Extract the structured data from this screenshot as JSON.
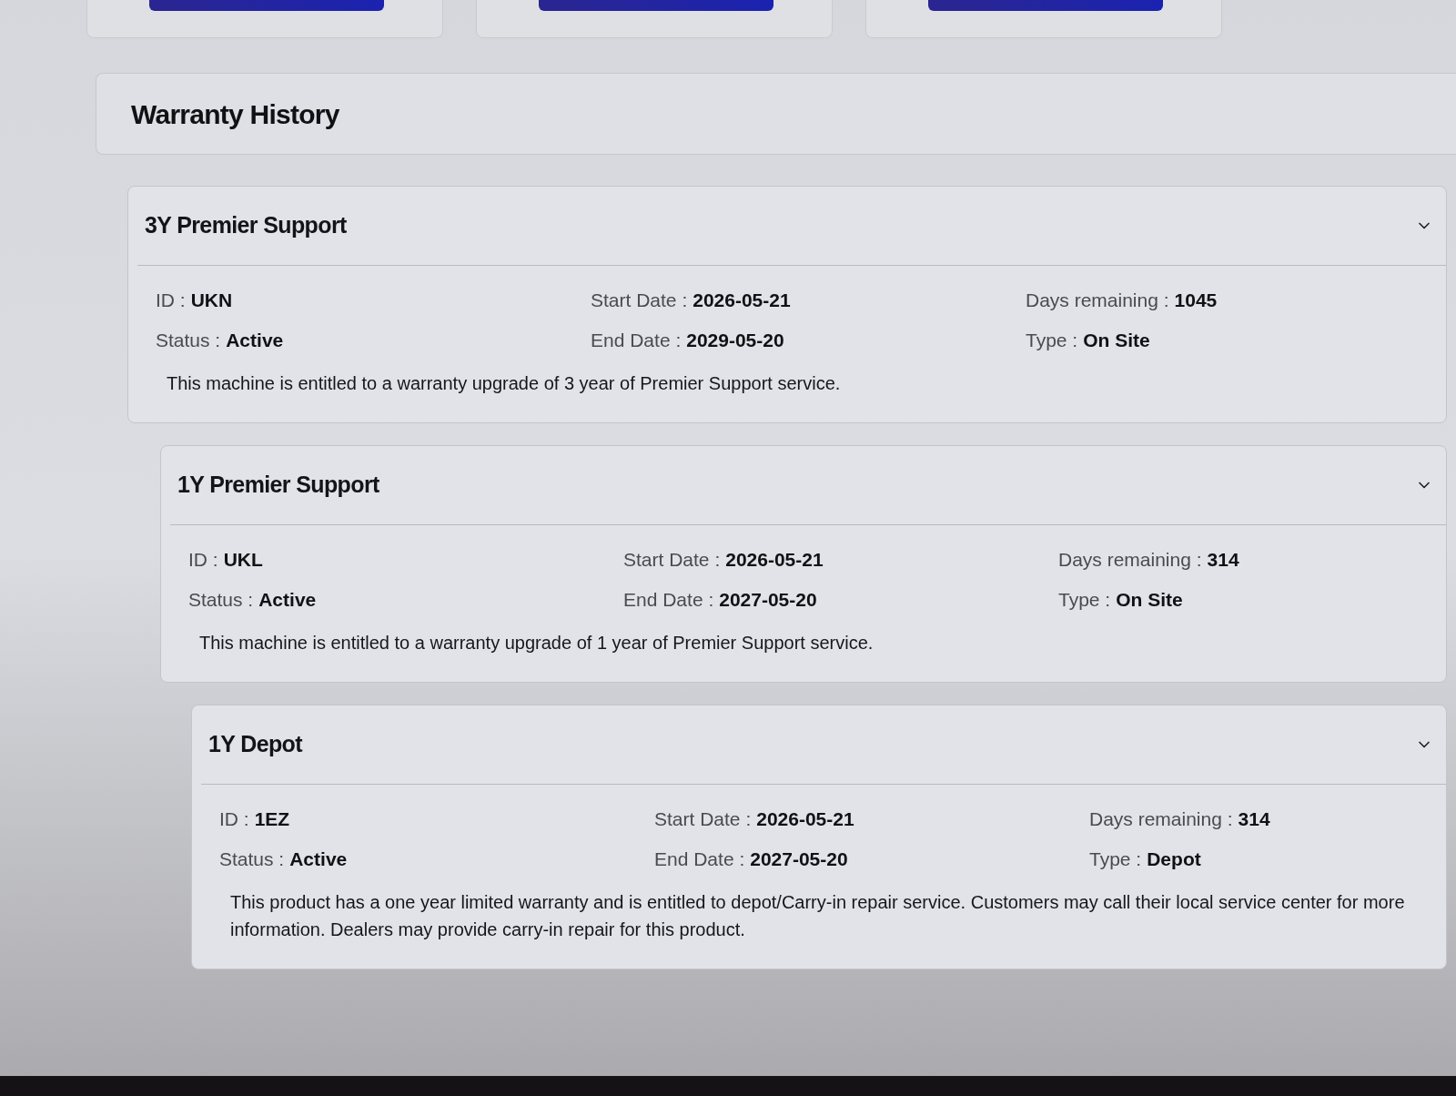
{
  "top_cards": [
    {
      "kind": "button"
    },
    {
      "kind": "button"
    },
    {
      "kind": "button"
    }
  ],
  "warranty_history": {
    "title": "Warranty History",
    "entries": [
      {
        "title": "3Y Premier Support",
        "expanded": true,
        "rows": [
          [
            {
              "label": "ID :",
              "value": "UKN"
            },
            {
              "label": "Start Date :",
              "value": "2026-05-21"
            },
            {
              "label": "Days remaining :",
              "value": "1045"
            }
          ],
          [
            {
              "label": "Status :",
              "value": "Active"
            },
            {
              "label": "End Date :",
              "value": "2029-05-20"
            },
            {
              "label": "Type :",
              "value": "On Site"
            }
          ]
        ],
        "description": "This machine is entitled to a warranty upgrade of 3 year of Premier Support service."
      },
      {
        "title": "1Y Premier Support",
        "expanded": true,
        "rows": [
          [
            {
              "label": "ID :",
              "value": "UKL"
            },
            {
              "label": "Start Date :",
              "value": "2026-05-21"
            },
            {
              "label": "Days remaining :",
              "value": "314"
            }
          ],
          [
            {
              "label": "Status :",
              "value": "Active"
            },
            {
              "label": "End Date :",
              "value": "2027-05-20"
            },
            {
              "label": "Type :",
              "value": "On Site"
            }
          ]
        ],
        "description": "This machine is entitled to a warranty upgrade of 1 year of Premier Support service."
      },
      {
        "title": "1Y Depot",
        "expanded": true,
        "rows": [
          [
            {
              "label": "ID :",
              "value": "1EZ"
            },
            {
              "label": "Start Date :",
              "value": "2026-05-21"
            },
            {
              "label": "Days remaining :",
              "value": "314"
            }
          ],
          [
            {
              "label": "Status :",
              "value": "Active"
            },
            {
              "label": "End Date :",
              "value": "2027-05-20"
            },
            {
              "label": "Type :",
              "value": "Depot"
            }
          ]
        ],
        "description": "This product has a one year limited warranty and is entitled to depot/Carry-in repair service. Customers may call their local service center for more information. Dealers may provide carry-in repair for this product."
      }
    ]
  }
}
